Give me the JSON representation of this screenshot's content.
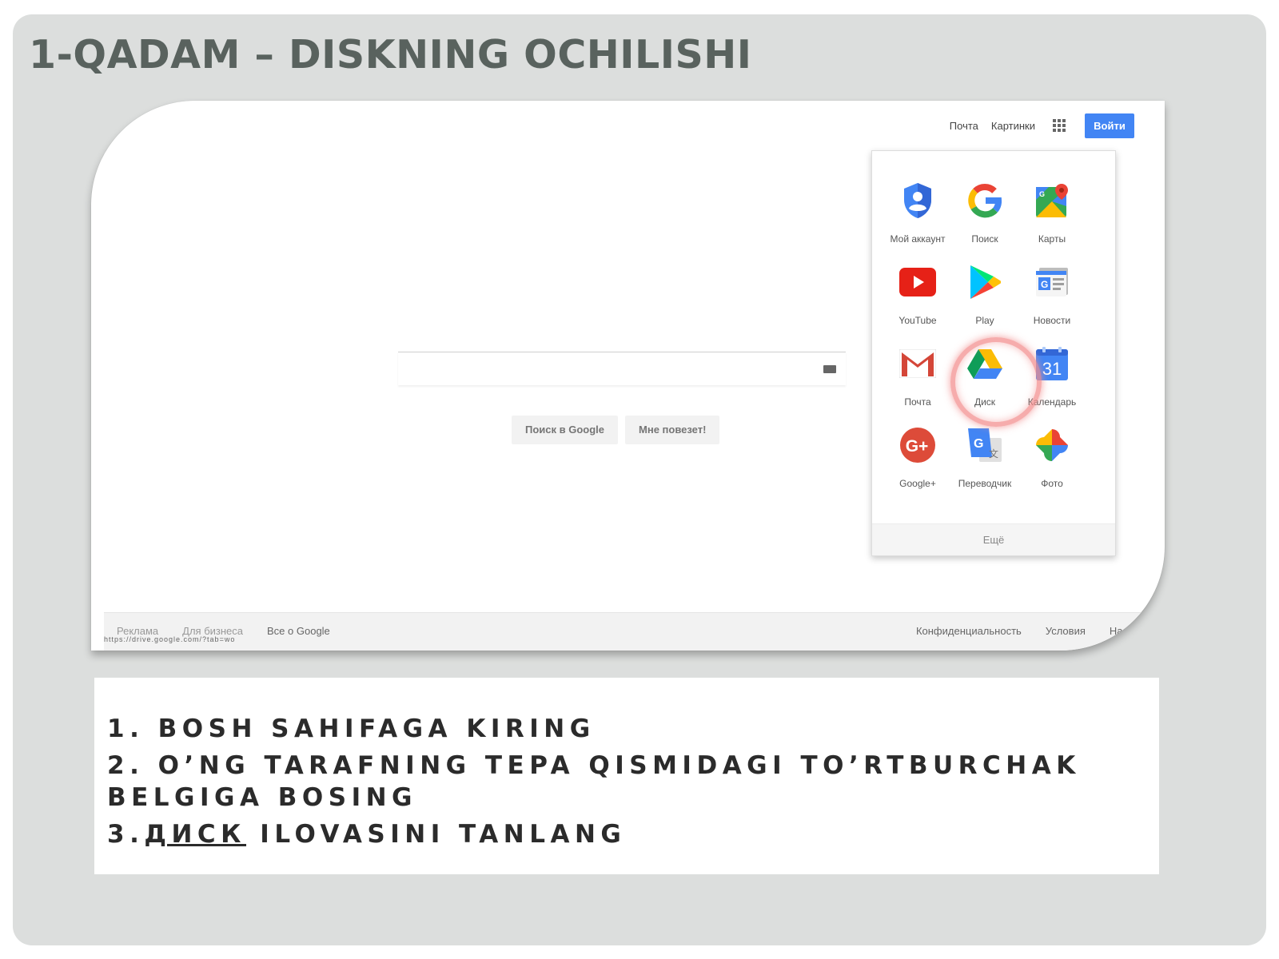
{
  "slide": {
    "title": "1-QADAM – DISKNING OCHILISHI"
  },
  "browser": {
    "top_links": [
      "Почта",
      "Картинки"
    ],
    "signin_label": "Войти",
    "buttons": [
      "Поиск в Google",
      "Мне повезет!"
    ],
    "footer_left": [
      "Реклама",
      "Для бизнеса",
      "Все о Google"
    ],
    "footer_right": [
      "Конфиденциальность",
      "Условия",
      "Нас"
    ],
    "status_url": "https://drive.google.com/?tab=wo"
  },
  "launcher": {
    "apps": [
      {
        "label": "Мой аккаунт",
        "icon": "account-shield-icon"
      },
      {
        "label": "Поиск",
        "icon": "google-g-icon"
      },
      {
        "label": "Карты",
        "icon": "maps-icon"
      },
      {
        "label": "YouTube",
        "icon": "youtube-icon"
      },
      {
        "label": "Play",
        "icon": "play-icon"
      },
      {
        "label": "Новости",
        "icon": "news-icon"
      },
      {
        "label": "Почта",
        "icon": "gmail-icon"
      },
      {
        "label": "Диск",
        "icon": "drive-icon"
      },
      {
        "label": "Календарь",
        "icon": "calendar-icon"
      },
      {
        "label": "Google+",
        "icon": "google-plus-icon"
      },
      {
        "label": "Переводчик",
        "icon": "translate-icon"
      },
      {
        "label": "Фото",
        "icon": "photos-icon"
      }
    ],
    "calendar_day": "31",
    "more_label": "Ещё"
  },
  "instructions": {
    "step1": "1. Bosh sahifaga kiring",
    "step2": "2. O’ng tarafning tepa qismidagi to’rtburchak belgiga bosing",
    "step3_prefix": "3.",
    "step3_link": "Диск",
    "step3_rest": " ilovasini tanlang"
  },
  "colors": {
    "slide_bg": "#dcdedd",
    "title": "#59625e",
    "signin": "#4285f4",
    "highlight": "#f28c8c"
  }
}
